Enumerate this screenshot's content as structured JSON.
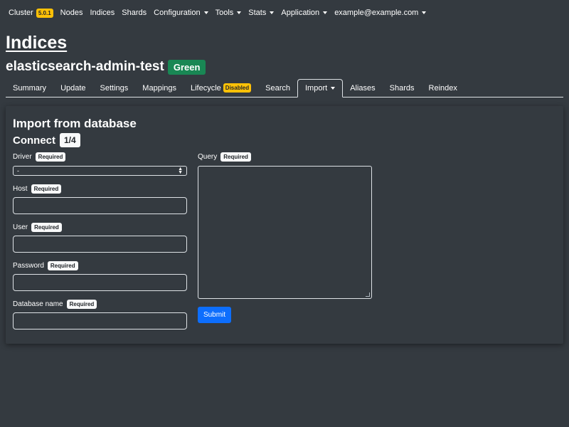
{
  "navbar": {
    "cluster_label": "Cluster",
    "version": "5.0.1",
    "items": [
      "Nodes",
      "Indices",
      "Shards"
    ],
    "dropdowns": [
      "Configuration",
      "Tools",
      "Stats",
      "Application",
      "example@example.com"
    ]
  },
  "page": {
    "title": "Indices",
    "index_name": "elasticsearch-admin-test",
    "health": "Green",
    "health_color": "#198754"
  },
  "tabs": {
    "summary": "Summary",
    "update": "Update",
    "settings": "Settings",
    "mappings": "Mappings",
    "lifecycle": "Lifecycle",
    "lifecycle_badge": "Disabled",
    "search": "Search",
    "import": "Import",
    "aliases": "Aliases",
    "shards": "Shards",
    "reindex": "Reindex",
    "active": "Import"
  },
  "form": {
    "title": "Import from database",
    "step_title": "Connect",
    "step": "1/4",
    "required_label": "Required",
    "driver_label": "Driver",
    "driver_value": "-",
    "host_label": "Host",
    "user_label": "User",
    "password_label": "Password",
    "database_label": "Database name",
    "query_label": "Query",
    "submit_label": "Submit"
  },
  "colors": {
    "background": "#343a40",
    "accent": "#0d6efd",
    "warning": "#ffc107",
    "success": "#198754"
  }
}
